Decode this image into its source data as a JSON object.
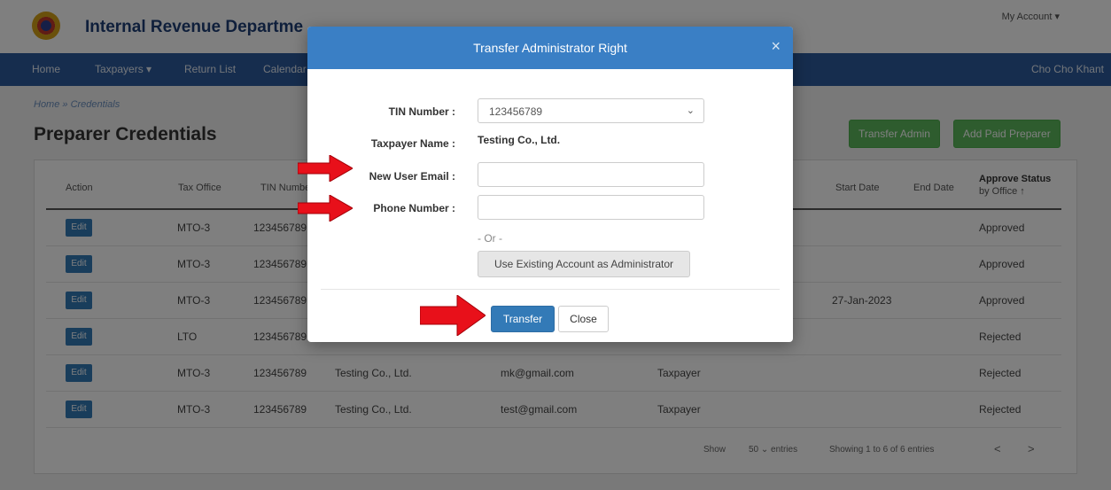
{
  "header": {
    "brand": "Internal Revenue Departme",
    "my_account": "My Account ▾"
  },
  "nav": {
    "items": [
      "Home",
      "Taxpayers ▾",
      "Return List",
      "Calendar"
    ],
    "user": "Cho Cho Khant"
  },
  "breadcrumb": "Home  »  Credentials",
  "page_title": "Preparer Credentials",
  "buttons": {
    "transfer_admin": "Transfer Admin",
    "add_paid_preparer": "Add Paid Preparer"
  },
  "table": {
    "headers": {
      "action": "Action",
      "tax_office": "Tax Office",
      "tin_number": "TIN Numbe",
      "start_date": "Start Date",
      "end_date": "End Date",
      "approve_status_line1": "Approve Status",
      "approve_status_line2": "by Office ↑"
    },
    "edit_label": "Edit",
    "rows": [
      {
        "office": "MTO-3",
        "tin": "123456789",
        "name": "",
        "email": "",
        "role": "",
        "start": "",
        "status": "Approved"
      },
      {
        "office": "MTO-3",
        "tin": "123456789",
        "name": "",
        "email": "",
        "role": "",
        "start": "",
        "status": "Approved"
      },
      {
        "office": "MTO-3",
        "tin": "123456789",
        "name": "",
        "email": "",
        "role": "",
        "start": "27-Jan-2023",
        "status": "Approved"
      },
      {
        "office": "LTO",
        "tin": "123456789",
        "name": "",
        "email": "",
        "role": "",
        "start": "",
        "status": "Rejected"
      },
      {
        "office": "MTO-3",
        "tin": "123456789",
        "name": "Testing Co., Ltd.",
        "email": "mk@gmail.com",
        "role": "Taxpayer",
        "start": "",
        "status": "Rejected"
      },
      {
        "office": "MTO-3",
        "tin": "123456789",
        "name": "Testing Co., Ltd.",
        "email": "test@gmail.com",
        "role": "Taxpayer",
        "start": "",
        "status": "Rejected"
      }
    ]
  },
  "pager": {
    "show": "Show",
    "entries_select": "50 ⌄ entries",
    "summary": "Showing 1 to 6 of 6 entries",
    "prev": "<",
    "next": ">"
  },
  "modal": {
    "title": "Transfer Administrator Right",
    "close_x": "×",
    "tin_label": "TIN Number :",
    "tin_value": "123456789",
    "taxpayer_label": "Taxpayer Name :",
    "taxpayer_value": "Testing Co., Ltd.",
    "email_label": "New User Email :",
    "email_value": "",
    "phone_label": "Phone Number :",
    "phone_value": "",
    "or_text": "- Or -",
    "existing_button": "Use Existing Account as Administrator",
    "transfer_button": "Transfer",
    "close_button": "Close"
  },
  "colors": {
    "accent": "#337ab7",
    "nav": "#2c5a9c",
    "success": "#5cb85c",
    "arrow": "#e8101a"
  }
}
